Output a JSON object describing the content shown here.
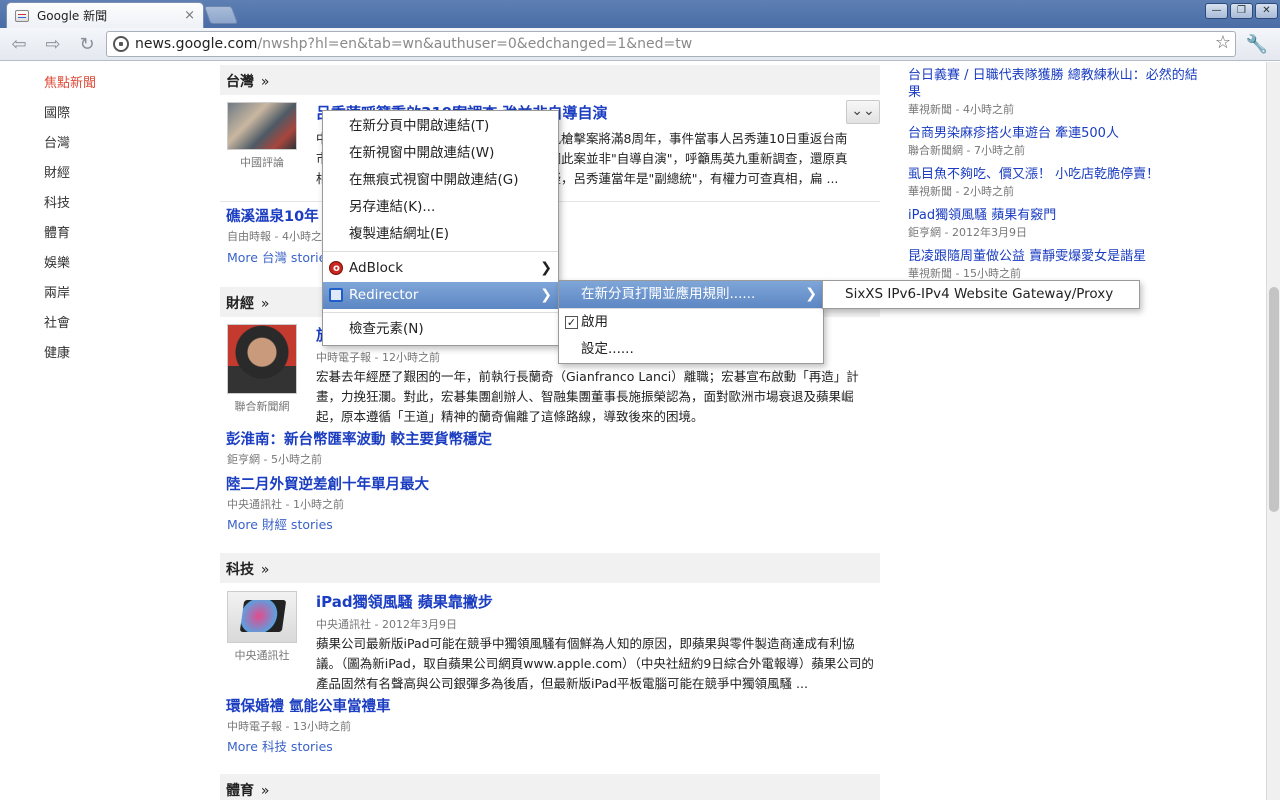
{
  "browser": {
    "tab_title": "Google 新聞",
    "tab_close": "×",
    "url_host": "news.google.com",
    "url_path": "/nwshp?hl=en&tab=wn&authuser=0&edchanged=1&ned=tw",
    "window_buttons": [
      "—",
      "❐",
      "✕"
    ]
  },
  "leftnav": [
    "焦點新聞",
    "國際",
    "台灣",
    "財經",
    "科技",
    "體育",
    "娛樂",
    "兩岸",
    "社會",
    "健康"
  ],
  "sections": {
    "taiwan": {
      "title": "台灣",
      "raquo": "»",
      "headline": "呂秀蓮呼籲重啟319案調查 強並非自導自演",
      "thumb_source": "中國評論",
      "snippet_partial": [
        "九槍擊案將滿8周年，事件當事人呂秀蓮10日重返台南",
        "調此案並非\"自導自演\"，呼籲馬英九重新調查，還原真",
        "疑，呂秀蓮當年是\"副總統\"，有權力可查真相，扁 ..."
      ],
      "snippet_edge_chars": [
        "中",
        "市",
        "相"
      ],
      "source_partial": "自由時報 - 4小時之",
      "sub_headline": "礁溪溫泉10年",
      "more": "More 台灣 stories"
    },
    "finance": {
      "title": "財經",
      "raquo": "»",
      "headline_partial": "旅",
      "thumb_source": "聯合新聞網",
      "source": "中時電子報 - 12小時之前",
      "snippet": "宏碁去年經歷了艱困的一年，前執行長蘭奇（Gianfranco Lanci）離職；宏碁宣布啟動「再造」計畫，力挽狂瀾。對此，宏碁集團創辦人、智融集團董事長施振榮認為，面對歐洲市場衰退及蘋果崛起，原本遵循「王道」精神的蘭奇偏離了這條路線，導致後來的困境。",
      "sub1": "彭淮南：新台幣匯率波動 較主要貨幣穩定",
      "sub1_src": "鉅亨網 - 5小時之前",
      "sub2": "陸二月外貿逆差創十年單月最大",
      "sub2_src": "中央通訊社 - 1小時之前",
      "more": "More 財經 stories"
    },
    "tech": {
      "title": "科技",
      "raquo": "»",
      "headline": "iPad獨領風騷 蘋果靠撇步",
      "thumb_source": "中央通訊社",
      "source": "中央通訊社 - 2012年3月9日",
      "snippet": "蘋果公司最新版iPad可能在競爭中獨領風騷有個鮮為人知的原因，即蘋果與零件製造商達成有利協議。（圖為新iPad，取自蘋果公司網頁www.apple.com）（中央社紐約9日綜合外電報導）蘋果公司的產品固然有名聲高與公司銀彈多為後盾，但最新版iPad平板電腦可能在競爭中獨領風騷 ...",
      "sub1": "環保婚禮 氫能公車當禮車",
      "sub1_src": "中時電子報 - 13小時之前",
      "more": "More 科技 stories"
    },
    "sports": {
      "title": "體育",
      "raquo": "»"
    }
  },
  "rightcol": [
    {
      "title": "台日義賽 / 日職代表隊獲勝 總教練秋山：必然的結果",
      "src": "華視新聞 - 4小時之前"
    },
    {
      "title": "台商男染麻疹搭火車遊台 牽連500人",
      "src": "聯合新聞網 - 7小時之前"
    },
    {
      "title": "虱目魚不夠吃、價又漲！ 小吃店乾脆停賣！",
      "src": "華視新聞 - 2小時之前"
    },
    {
      "title": "iPad獨領風騷 蘋果有竅門",
      "src": "鉅亨網 - 2012年3月9日"
    },
    {
      "title": "昆凌跟隨周董做公益 賣靜雯爆愛女是諧星",
      "src": "華視新聞 - 15小時之前"
    }
  ],
  "context_menu": {
    "items": [
      "在新分頁中開啟連結(T)",
      "在新視窗中開啟連結(W)",
      "在無痕式視窗中開啟連結(G)",
      "另存連結(K)...",
      "複製連結網址(E)"
    ],
    "adblock": "AdBlock",
    "redirector": "Redirector",
    "inspect": "檢查元素(N)",
    "submenu_rule": "在新分頁打開並應用規則......",
    "enable": "啟用",
    "settings": "設定......",
    "gateway": "SixXS IPv6-IPv4 Website Gateway/Proxy"
  }
}
